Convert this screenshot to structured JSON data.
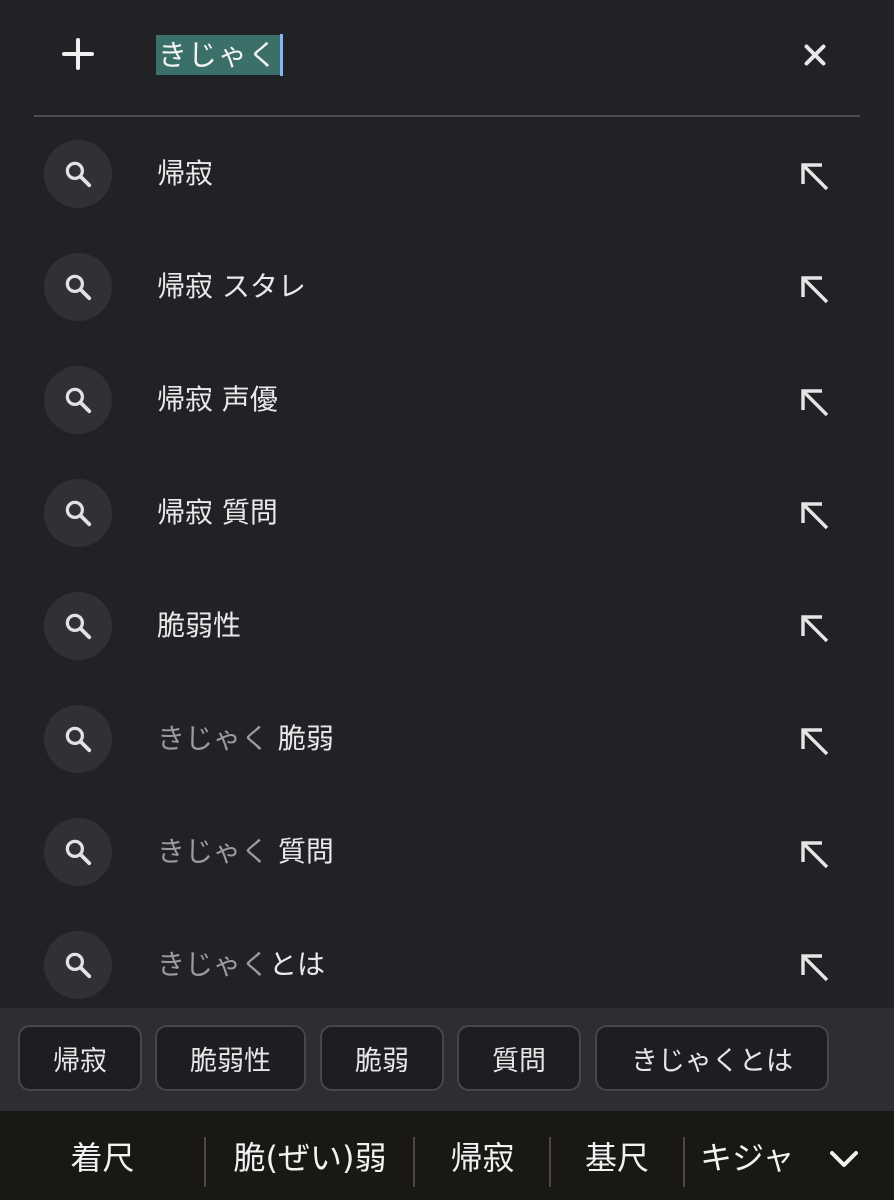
{
  "search": {
    "query": "きじゃく",
    "add_icon": "plus-icon",
    "clear_icon": "close-icon"
  },
  "suggestions": [
    {
      "prefix": "",
      "text": "帰寂"
    },
    {
      "prefix": "",
      "text": "帰寂 スタレ"
    },
    {
      "prefix": "",
      "text": "帰寂 声優"
    },
    {
      "prefix": "",
      "text": "帰寂 質問"
    },
    {
      "prefix": "",
      "text": "脆弱性"
    },
    {
      "prefix": "きじゃく",
      "text": " 脆弱"
    },
    {
      "prefix": "きじゃく",
      "text": " 質問"
    },
    {
      "prefix": "きじゃく",
      "text": "とは"
    }
  ],
  "chips": [
    "帰寂",
    "脆弱性",
    "脆弱",
    "質問",
    "きじゃくとは"
  ],
  "candidates": [
    "着尺",
    "脆(ぜい)弱",
    "帰寂",
    "基尺",
    "キジャ"
  ],
  "colors": {
    "background": "#212226",
    "selection": "#3b6f6a",
    "caret": "#8ab4f8",
    "chip_bar": "#2c2e33",
    "candidate_bar": "#1a1815"
  }
}
